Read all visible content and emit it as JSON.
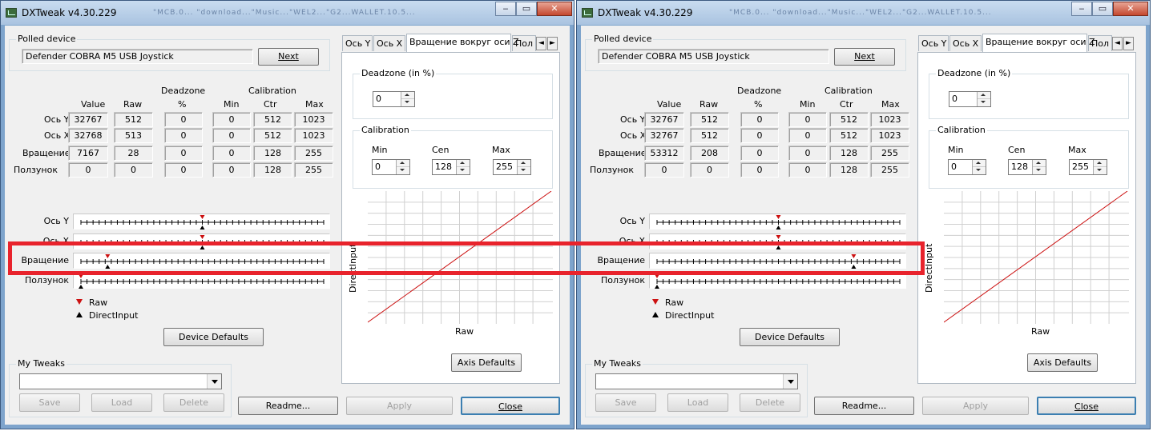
{
  "app": {
    "title": "DXTweak v4.30.229",
    "ghost_title": "\"MCB.0... \"download...\"Music...\"WEL2...\"G2...WALLET.10.5...",
    "accent_color": "#3c7fb1"
  },
  "labels": {
    "polled_device": "Polled device",
    "next": "Next",
    "col_deadzone": "Deadzone",
    "col_calibration": "Calibration",
    "col_value": "Value",
    "col_raw": "Raw",
    "col_pct": "%",
    "col_min": "Min",
    "col_ctr": "Ctr",
    "col_max": "Max",
    "legend_raw": "Raw",
    "legend_di": "DirectInput",
    "device_defaults": "Device Defaults",
    "my_tweaks": "My Tweaks",
    "save": "Save",
    "load": "Load",
    "delete": "Delete",
    "readme": "Readme...",
    "apply": "Apply",
    "close": "Close",
    "deadzone_in_pct": "Deadzone (in %)",
    "calibration": "Calibration",
    "min": "Min",
    "cen": "Cen",
    "max": "Max",
    "graph_x": "Raw",
    "graph_y": "DirectInput",
    "axis_defaults": "Axis Defaults",
    "tabs": [
      "Ось Y",
      "Ось X",
      "Вращение вокруг оси Z",
      "Пол"
    ],
    "tab_left_scroll": "◄",
    "tab_right_scroll": "►",
    "axes": [
      "Ось Y",
      "Ось X",
      "Вращение",
      "Ползунок"
    ]
  },
  "windows": [
    {
      "device": "Defender COBRA M5 USB Joystick",
      "rows": [
        {
          "value": "32767",
          "raw": "512",
          "dz": "0",
          "min": "0",
          "ctr": "512",
          "max": "1023"
        },
        {
          "value": "32768",
          "raw": "513",
          "dz": "0",
          "min": "0",
          "ctr": "512",
          "max": "1023"
        },
        {
          "value": "7167",
          "raw": "28",
          "dz": "0",
          "min": "0",
          "ctr": "128",
          "max": "255"
        },
        {
          "value": "0",
          "raw": "0",
          "dz": "0",
          "min": "0",
          "ctr": "128",
          "max": "255"
        }
      ],
      "slider_positions": [
        0.5,
        0.5,
        0.11,
        0.0
      ],
      "deadzone": "0",
      "cal_min": "0",
      "cal_cen": "128",
      "cal_max": "255"
    },
    {
      "device": "Defender COBRA M5 USB Joystick",
      "rows": [
        {
          "value": "32767",
          "raw": "512",
          "dz": "0",
          "min": "0",
          "ctr": "512",
          "max": "1023"
        },
        {
          "value": "32767",
          "raw": "512",
          "dz": "0",
          "min": "0",
          "ctr": "512",
          "max": "1023"
        },
        {
          "value": "53312",
          "raw": "208",
          "dz": "0",
          "min": "0",
          "ctr": "128",
          "max": "255"
        },
        {
          "value": "0",
          "raw": "0",
          "dz": "0",
          "min": "0",
          "ctr": "128",
          "max": "255"
        }
      ],
      "slider_positions": [
        0.5,
        0.5,
        0.81,
        0.0
      ],
      "deadzone": "0",
      "cal_min": "0",
      "cal_cen": "128",
      "cal_max": "255"
    }
  ],
  "colors": {
    "raw_marker": "#cc1111",
    "di_marker": "#000000",
    "highlight_box": "#e8232c",
    "graph_line": "#cc1111"
  }
}
